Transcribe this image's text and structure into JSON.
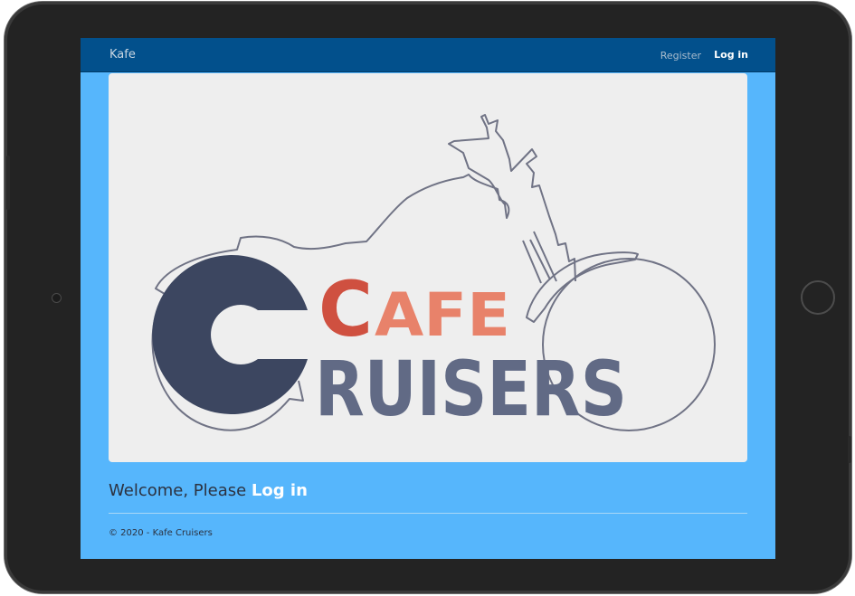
{
  "navbar": {
    "brand": "Kafe",
    "register_label": "Register",
    "login_label": "Log in"
  },
  "hero": {
    "logo_word_1": "CAFE",
    "logo_word_2": "RUISERS",
    "logo_letter_c": "C"
  },
  "main": {
    "welcome_prefix": "Welcome, Please ",
    "welcome_link": "Log in"
  },
  "footer": {
    "text": "© 2020 - Kafe Cruisers"
  },
  "colors": {
    "navbar": "#02508c",
    "page_background": "#56b6fc",
    "hero_background": "#eeeeee",
    "logo_dark": "#3c4660",
    "logo_red": "#cf5040",
    "logo_peach": "#f0a98c",
    "outline": "#707385"
  }
}
